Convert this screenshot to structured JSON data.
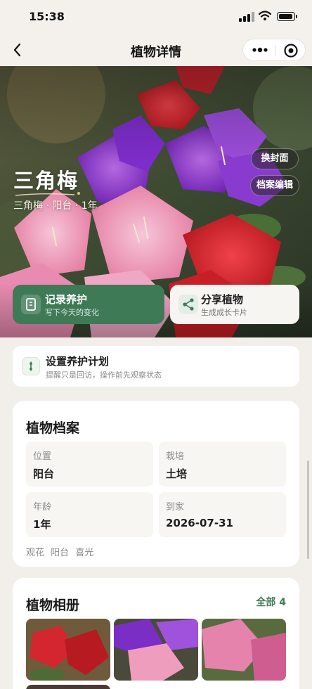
{
  "status_bar": {
    "time": "15:38"
  },
  "nav": {
    "title": "植物详情"
  },
  "hero": {
    "name": "三角梅",
    "meta": "三角梅 · 阳台 · 1年",
    "cover_btn": "换封面",
    "edit_btn": "档案编辑"
  },
  "actions": {
    "record": {
      "title": "记录养护",
      "sub": "写下今天的变化"
    },
    "share": {
      "title": "分享植物",
      "sub": "生成成长卡片"
    }
  },
  "plan": {
    "title": "设置养护计划",
    "sub": "提醒只是回访，操作前先观察状态"
  },
  "archive": {
    "title": "植物档案",
    "fields": [
      {
        "label": "位置",
        "value": "阳台"
      },
      {
        "label": "栽培",
        "value": "土培"
      },
      {
        "label": "年龄",
        "value": "1年"
      },
      {
        "label": "到家",
        "value": "2026-07-31"
      }
    ],
    "tags": [
      "观花",
      "阳台",
      "喜光"
    ]
  },
  "album": {
    "title": "植物相册",
    "all_label": "全部 4"
  },
  "colors": {
    "accent": "#3f7a57",
    "background": "#f2efea"
  },
  "icons": [
    "back-icon",
    "more-dots-icon",
    "target-icon",
    "notebook-icon",
    "share-icon",
    "plan-icon"
  ]
}
